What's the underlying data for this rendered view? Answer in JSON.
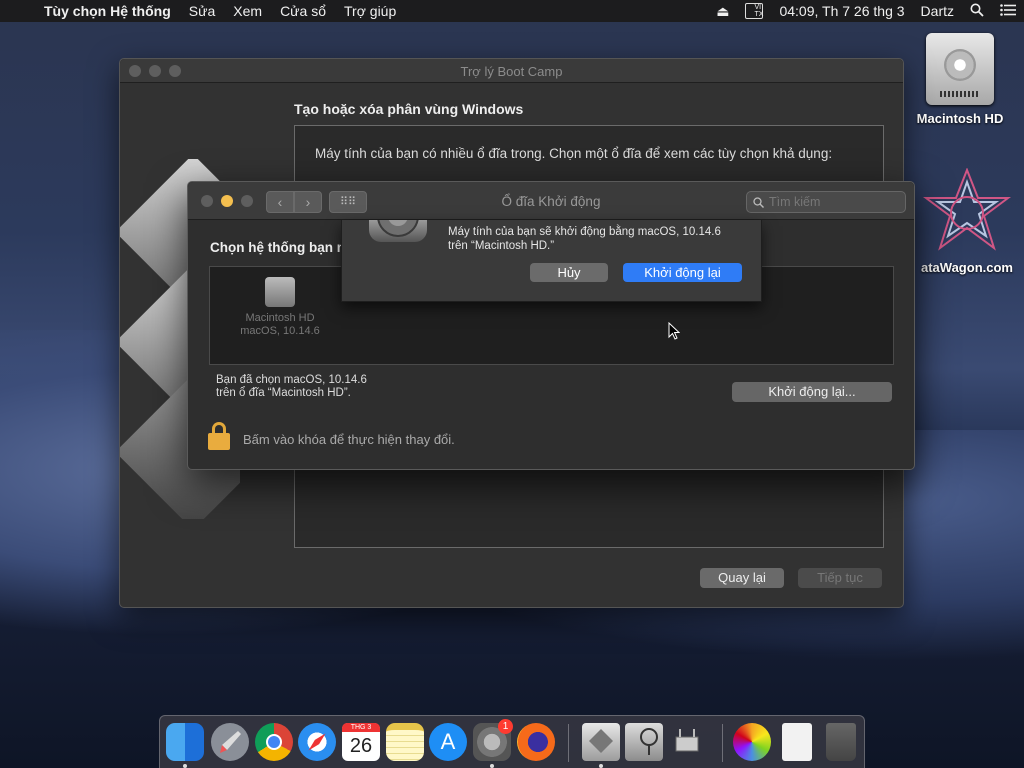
{
  "menubar": {
    "app_name": "Tùy chọn Hệ thống",
    "items": [
      "Sửa",
      "Xem",
      "Cửa sổ",
      "Trợ giúp"
    ],
    "input_source": "VI TX",
    "clock": "04:09, Th 7 26 thg 3",
    "user": "Dartz"
  },
  "desktop": {
    "hdd_label": "Macintosh HD",
    "datawagon_label": "ataWagon.com"
  },
  "bootcamp": {
    "title": "Trợ lý Boot Camp",
    "heading": "Tạo hoặc xóa phân vùng Windows",
    "description": "Máy tính của bạn có nhiều ổ đĩa trong. Chọn một ổ đĩa để xem các tùy chọn khả dụng:",
    "back_label": "Quay lại",
    "continue_label": "Tiếp tục"
  },
  "startup_disk": {
    "title": "Ổ đĩa Khởi động",
    "search_placeholder": "Tìm kiếm",
    "choose_label": "Chọn hệ thống bạn m",
    "disk_name": "Macintosh HD",
    "disk_os": "macOS, 10.14.6",
    "selected_line1": "Bạn đã chọn macOS, 10.14.6",
    "selected_line2": "trên ổ đĩa “Macintosh HD”.",
    "restart_label": "Khởi động lại...",
    "lock_text": "Bấm vào khóa để thực hiện thay đổi."
  },
  "alert": {
    "message_line1": "Máy tính của bạn sẽ khởi động bằng macOS, 10.14.6",
    "message_line2": "trên “Macintosh HD.”",
    "cancel_label": "Hủy",
    "restart_label": "Khởi động lại"
  },
  "dock": {
    "calendar_month": "THG 3",
    "calendar_day": "26",
    "badge_count": "1",
    "apps": [
      "finder-icon",
      "launchpad-icon",
      "chrome-icon",
      "safari-icon",
      "calendar-icon",
      "notes-icon",
      "app-store-icon",
      "system-preferences-icon",
      "firefox-icon",
      "boot-camp-icon",
      "disk-utility-icon",
      "system-information-icon",
      "photos-icon",
      "preview-icon",
      "trash-icon"
    ]
  },
  "colors": {
    "accent": "#2f7cf6",
    "lock": "#e9ac3e",
    "window_bg": "#323232"
  }
}
